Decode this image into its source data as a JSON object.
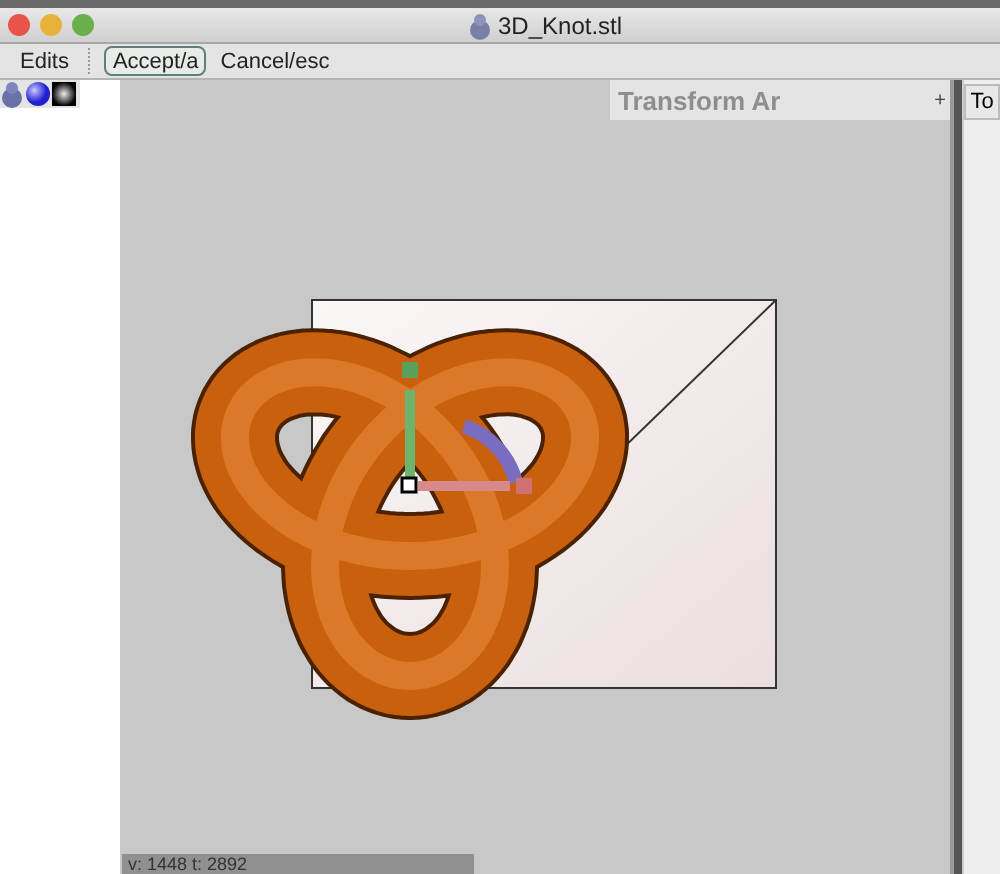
{
  "window": {
    "title": "3D_Knot.stl"
  },
  "toolbar": {
    "buttons": [
      {
        "label": "Edits",
        "selected": false
      },
      {
        "label": "Accept/a",
        "selected": true
      },
      {
        "label": "Cancel/esc",
        "selected": false
      }
    ]
  },
  "transform_panel": {
    "title": "Transform Ar",
    "expand": "+"
  },
  "right_tab": {
    "label": "To"
  },
  "status_bar": {
    "text": "v: 1448 t: 2892"
  }
}
